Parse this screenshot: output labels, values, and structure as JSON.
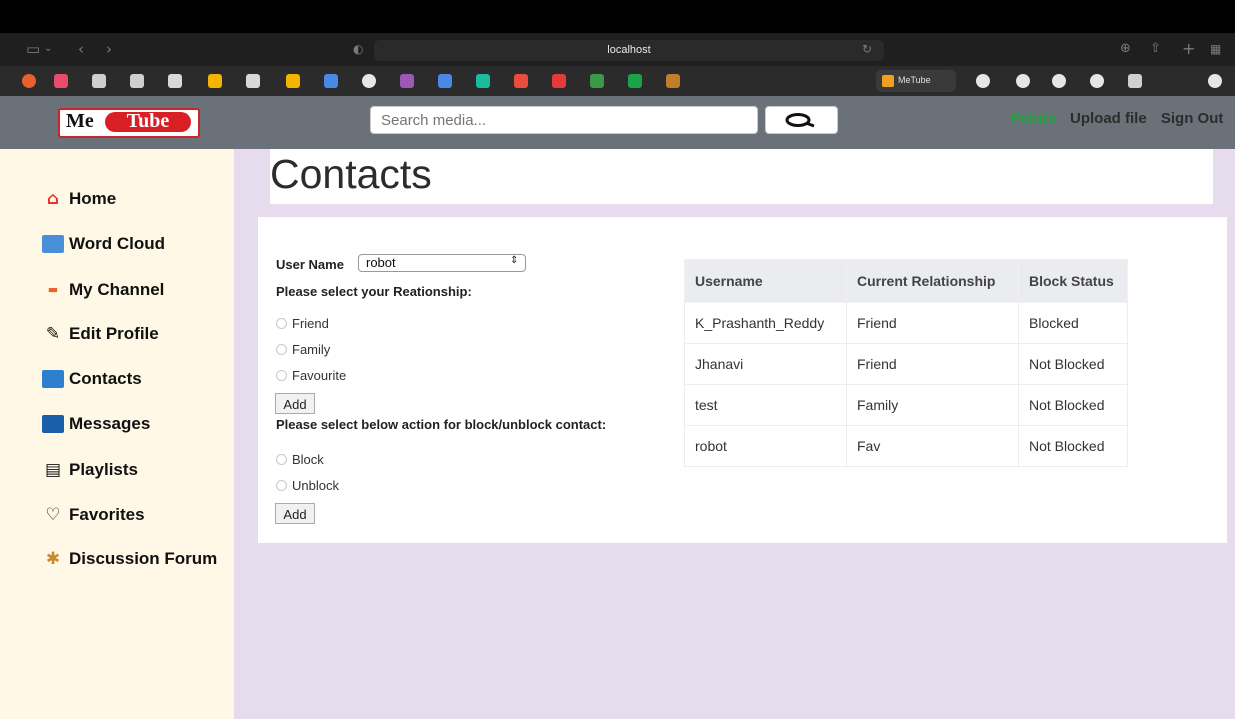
{
  "browser": {
    "url": "localhost",
    "active_tab_label": "MeTube"
  },
  "header": {
    "logo_me": "Me",
    "logo_tube": "Tube",
    "search_placeholder": "Search media...",
    "green_link": "Points",
    "upload_label": "Upload file",
    "signout_label": "Sign Out"
  },
  "sidebar": {
    "items": [
      {
        "label": "Home",
        "icon": "home-icon"
      },
      {
        "label": "Word Cloud",
        "icon": "word-cloud-icon"
      },
      {
        "label": "My Channel",
        "icon": "channel-icon"
      },
      {
        "label": "Edit Profile",
        "icon": "edit-profile-icon"
      },
      {
        "label": "Contacts",
        "icon": "contacts-icon"
      },
      {
        "label": "Messages",
        "icon": "messages-icon"
      },
      {
        "label": "Playlists",
        "icon": "playlists-icon"
      },
      {
        "label": "Favorites",
        "icon": "favorites-icon"
      },
      {
        "label": "Discussion Forum",
        "icon": "forum-icon"
      }
    ]
  },
  "page": {
    "title": "Contacts"
  },
  "form": {
    "user_name_label": "User Name",
    "user_name_value": "robot",
    "relationship_prompt": "Please select your Reationship:",
    "relationship_options": [
      "Friend",
      "Family",
      "Favourite"
    ],
    "add_label": "Add",
    "block_prompt": "Please select below action for block/unblock contact:",
    "block_options": [
      "Block",
      "Unblock"
    ],
    "add2_label": "Add"
  },
  "table": {
    "headers": [
      "Username",
      "Current Relationship",
      "Block Status"
    ],
    "rows": [
      [
        "K_Prashanth_Reddy",
        "Friend",
        "Blocked"
      ],
      [
        "Jhanavi",
        "Friend",
        "Not Blocked"
      ],
      [
        "test",
        "Family",
        "Not Blocked"
      ],
      [
        "robot",
        "Fav",
        "Not Blocked"
      ]
    ]
  },
  "colors": {
    "header_bg": "#6b7178",
    "sidebar_bg": "#fff8e6",
    "main_bg": "#e7dcee",
    "logo_red": "#d81f26",
    "points_green": "#1aa33a"
  }
}
